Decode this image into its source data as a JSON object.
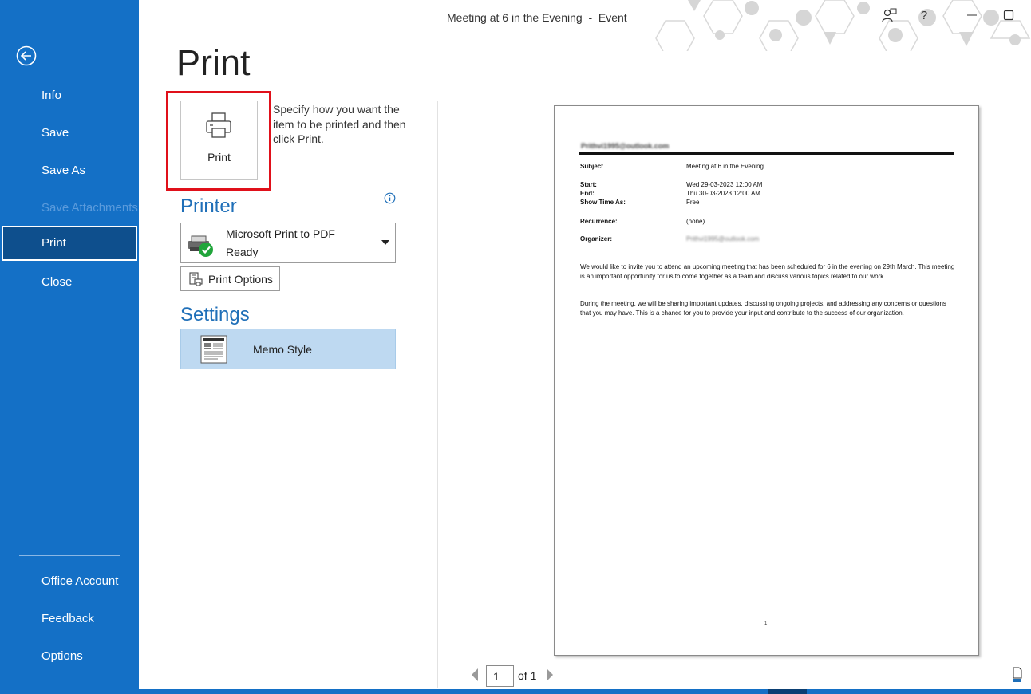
{
  "window": {
    "title": "Meeting at 6 in the Evening  -  Event"
  },
  "nav": {
    "back_icon": "arrow-left-circle-icon",
    "items": [
      {
        "label": "Info"
      },
      {
        "label": "Save"
      },
      {
        "label": "Save As"
      },
      {
        "label": "Save Attachments",
        "disabled": true
      },
      {
        "label": "Print",
        "selected": true
      },
      {
        "label": "Close"
      }
    ],
    "bottom_items": [
      {
        "label": "Office Account"
      },
      {
        "label": "Feedback"
      },
      {
        "label": "Options"
      }
    ]
  },
  "page": {
    "title": "Print",
    "print_button_label": "Print",
    "print_description": "Specify how you want the item to be printed and then click Print."
  },
  "printer": {
    "heading": "Printer",
    "name": "Microsoft Print to PDF",
    "status": "Ready",
    "options_label": "Print Options"
  },
  "settings": {
    "heading": "Settings",
    "style": "Memo Style"
  },
  "preview": {
    "email": "Prithvi1995@outlook.com",
    "fields": [
      {
        "label": "Subject",
        "value": "Meeting at 6 in the Evening"
      },
      {
        "label": "Start:",
        "value": "Wed 29-03-2023 12:00 AM"
      },
      {
        "label": "End:",
        "value": "Thu 30-03-2023 12:00 AM"
      },
      {
        "label": "Show Time As:",
        "value": "Free"
      },
      {
        "label": "Recurrence:",
        "value": "(none)"
      },
      {
        "label": "Organizer:",
        "value": "Prithvi1995@outlook.com"
      }
    ],
    "body_1": "We would like to invite you to attend an upcoming meeting that has been scheduled for 6 in the evening on 29th March. This meeting is an important opportunity for us to come together as a team and discuss various topics related to our work.",
    "body_2": "During the meeting, we will be sharing important updates, discussing ongoing projects, and addressing any concerns or questions that you may have. This is a chance for you to provide your input and contribute to the success of our organization.",
    "page_number": "1"
  },
  "pager": {
    "current": "1",
    "of_label": "of 1"
  },
  "colors": {
    "nav_bg": "#1470c6",
    "nav_selected": "#0e4f8d",
    "accent_heading": "#1f6fb8",
    "highlight_red": "#e0101a",
    "memo_selected": "#bed9f1"
  }
}
